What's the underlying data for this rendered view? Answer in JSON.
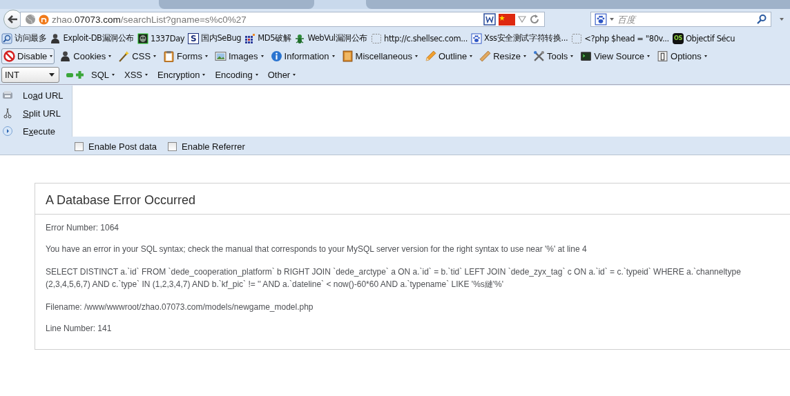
{
  "address_bar": {
    "host_prefix": "zhao.",
    "host": "07073.com",
    "path": "/searchList?gname=s%c0%27"
  },
  "search": {
    "placeholder": "百度"
  },
  "bookmarks": [
    {
      "kind": "search",
      "label": "访问最多"
    },
    {
      "kind": "person",
      "label": "Exploit-DB漏洞公布"
    },
    {
      "kind": "mask",
      "label": "1337Day"
    },
    {
      "kind": "letter",
      "icon_text": "S",
      "label": "国内SeBug"
    },
    {
      "kind": "grid",
      "label": "MD5破解"
    },
    {
      "kind": "bug",
      "label": "WebVul漏洞公布"
    },
    {
      "kind": "blank",
      "label": "http://c.shellsec.com..."
    },
    {
      "kind": "paw",
      "label": "Xss安全测试字符转换..."
    },
    {
      "kind": "blank",
      "label": "<?php $head = \"80v..."
    },
    {
      "kind": "badge",
      "icon_text": "OS",
      "label": "Objectif Sécu"
    }
  ],
  "hackbar_menu": [
    {
      "kind": "disable",
      "label": "Disable"
    },
    {
      "kind": "person",
      "label": "Cookies"
    },
    {
      "kind": "wand",
      "label": "CSS"
    },
    {
      "kind": "clipboard",
      "label": "Forms"
    },
    {
      "kind": "image",
      "label": "Images"
    },
    {
      "kind": "info",
      "label": "Information"
    },
    {
      "kind": "book",
      "label": "Miscellaneous"
    },
    {
      "kind": "pencil",
      "label": "Outline"
    },
    {
      "kind": "ruler",
      "label": "Resize"
    },
    {
      "kind": "tools",
      "label": "Tools"
    },
    {
      "kind": "terminal",
      "label": "View Source"
    },
    {
      "kind": "box",
      "label": "Options"
    }
  ],
  "hackbar_tools": {
    "select_value": "INT",
    "menus": [
      "SQL",
      "XSS",
      "Encryption",
      "Encoding",
      "Other"
    ]
  },
  "hackbar_actions": [
    {
      "kind": "load",
      "before": "Lo",
      "key": "a",
      "after": "d URL"
    },
    {
      "kind": "split",
      "key": "S",
      "after": "plit URL"
    },
    {
      "kind": "execute",
      "before": "E",
      "key": "x",
      "after": "ecute"
    }
  ],
  "hackbar_options": [
    {
      "label": "Enable Post data",
      "checked": false
    },
    {
      "label": "Enable Referrer",
      "checked": false
    }
  ],
  "error": {
    "title": "A Database Error Occurred",
    "number": "Error Number: 1064",
    "message": "You have an error in your SQL syntax; check the manual that corresponds to your MySQL server version for the right syntax to use near '%' at line 4",
    "query_lines": [
      "SELECT DISTINCT a.`id` FROM `dede_cooperation_platform` b RIGHT JOIN `dede_arctype` a ON a.`id` = b.`tid` LEFT JOIN `dede_zyx_tag` c ON a.`id` = c.`typeid` WHERE a.`channeltype",
      "(2,3,4,5,6,7) AND c.`type` IN (1,2,3,4,7) AND b.`kf_pic` != '' AND a.`dateline` < now()-60*60 AND a.`typename` LIKE '%s縺'%'"
    ],
    "filename": "Filename: /www/wwwroot/zhao.07073.com/models/newgame_model.php",
    "line": "Line Number: 141"
  }
}
